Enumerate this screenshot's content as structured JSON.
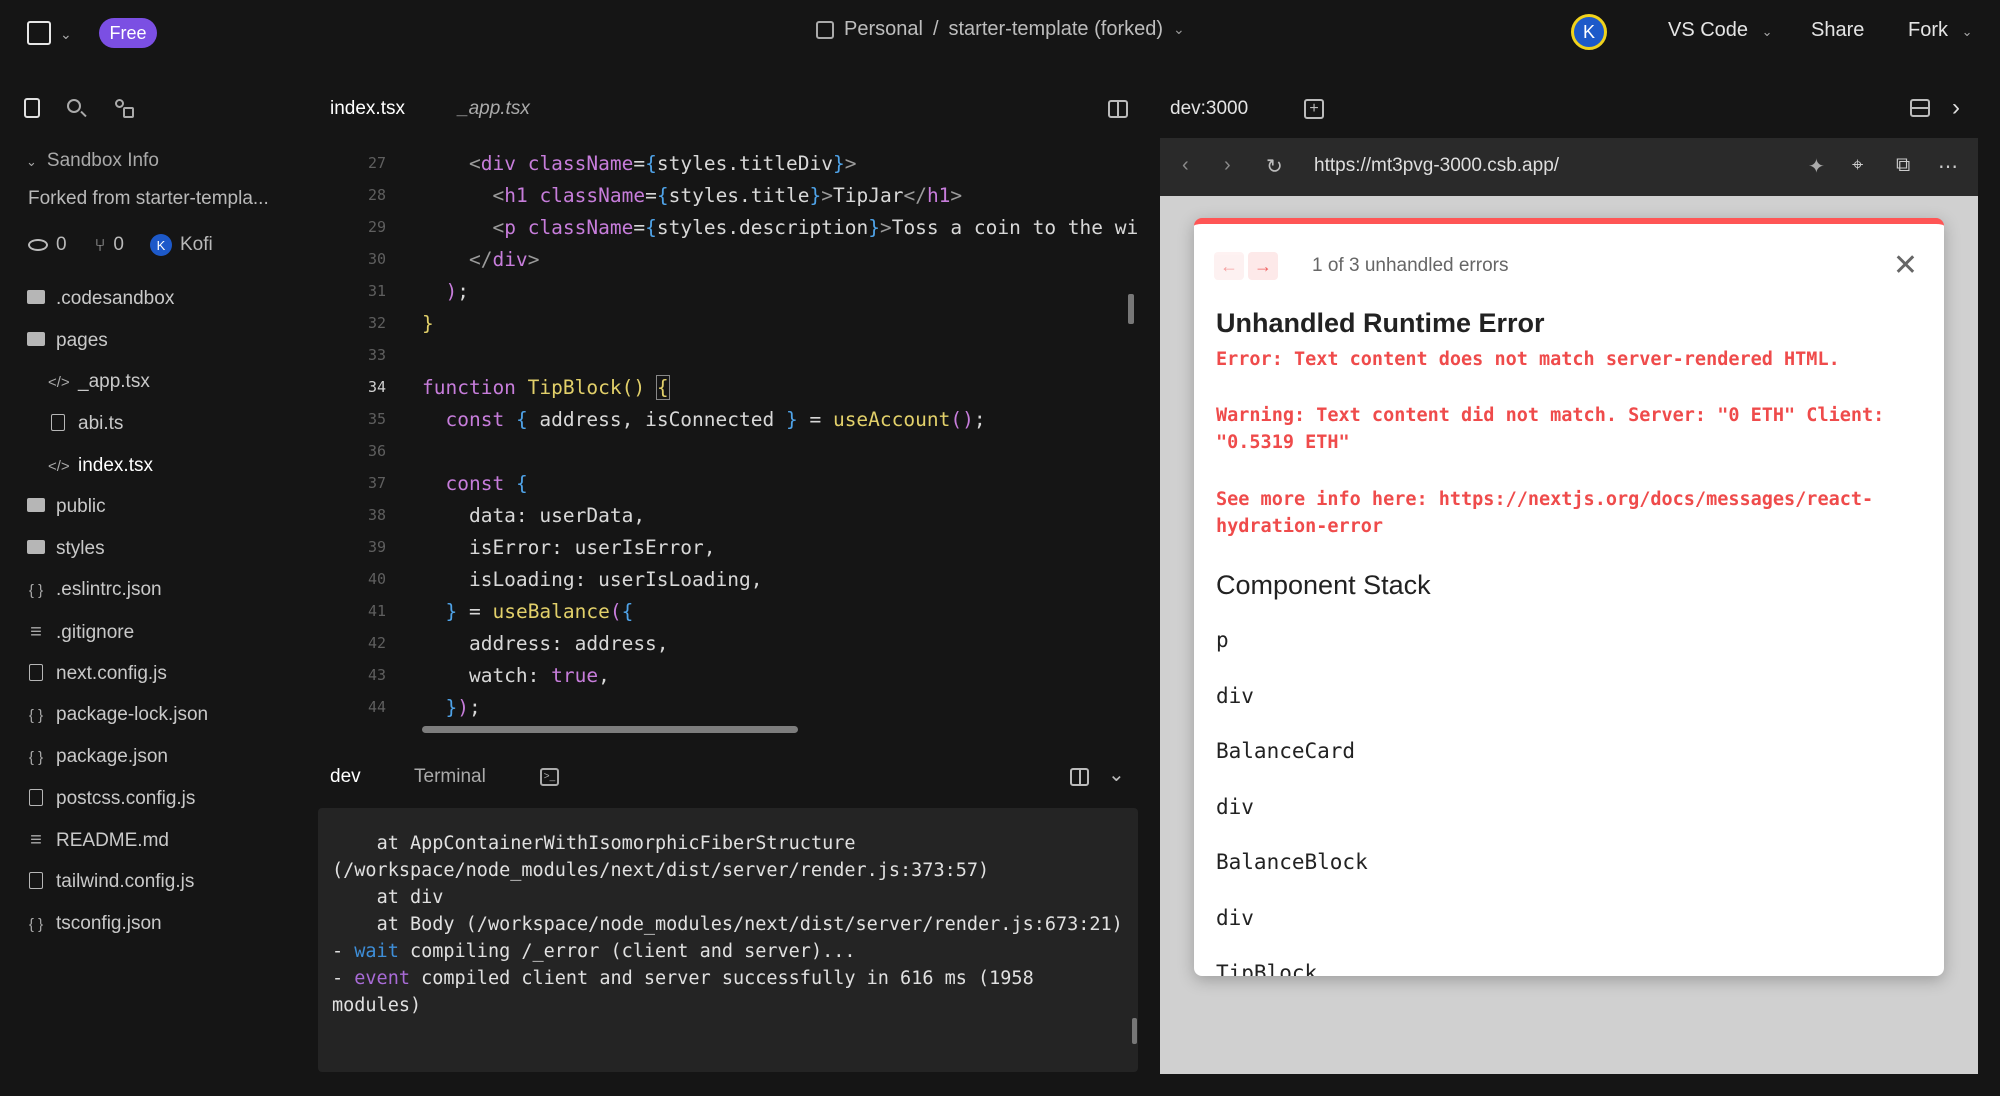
{
  "topbar": {
    "badge": "Free",
    "breadcrumb_workspace": "Personal",
    "breadcrumb_sep": "/",
    "breadcrumb_project": "starter-template (forked)",
    "avatar_letter": "K",
    "editor_select": "VS Code",
    "share": "Share",
    "fork": "Fork"
  },
  "sidebar": {
    "section_title": "Sandbox Info",
    "forked_from": "Forked from starter-templa...",
    "views": "0",
    "forks": "0",
    "author_initial": "K",
    "author": "Kofi",
    "tree": [
      {
        "label": ".codesandbox",
        "kind": "folder"
      },
      {
        "label": "pages",
        "kind": "folder-open"
      },
      {
        "label": "_app.tsx",
        "kind": "code"
      },
      {
        "label": "abi.ts",
        "kind": "file"
      },
      {
        "label": "index.tsx",
        "kind": "code"
      },
      {
        "label": "public",
        "kind": "folder"
      },
      {
        "label": "styles",
        "kind": "folder"
      },
      {
        "label": ".eslintrc.json",
        "kind": "json"
      },
      {
        "label": ".gitignore",
        "kind": "lines"
      },
      {
        "label": "next.config.js",
        "kind": "file"
      },
      {
        "label": "package-lock.json",
        "kind": "json"
      },
      {
        "label": "package.json",
        "kind": "json"
      },
      {
        "label": "postcss.config.js",
        "kind": "file"
      },
      {
        "label": "README.md",
        "kind": "lines"
      },
      {
        "label": "tailwind.config.js",
        "kind": "file"
      },
      {
        "label": "tsconfig.json",
        "kind": "json"
      }
    ]
  },
  "editor": {
    "tabs": [
      "index.tsx",
      "_app.tsx"
    ],
    "line_numbers": [
      "27",
      "28",
      "29",
      "30",
      "31",
      "32",
      "33",
      "34",
      "35",
      "36",
      "37",
      "38",
      "39",
      "40",
      "41",
      "42",
      "43",
      "44"
    ]
  },
  "terminal": {
    "tabs": [
      "dev",
      "Terminal"
    ],
    "lines": [
      "    at AppContainerWithIsomorphicFiberStructure (/workspace/node_modules/next/dist/server/render.js:373:57)",
      "    at div",
      "    at Body (/workspace/node_modules/next/dist/server/render.js:673:21)"
    ],
    "wait_prefix": "- ",
    "wait_word": "wait",
    "wait_rest": " compiling /_error (client and server)...",
    "event_prefix": "- ",
    "event_word": "event",
    "event_rest": " compiled client and server successfully in 616 ms (1958 modules)"
  },
  "preview": {
    "tab": "dev:3000",
    "url": "https://mt3pvg-3000.csb.app/",
    "error": {
      "count": "1 of 3 unhandled errors",
      "title": "Unhandled Runtime Error",
      "msg1": "Error: Text content does not match server-rendered HTML.",
      "msg2": "Warning: Text content did not match. Server: \"0 ETH\" Client: \"0.5319 ETH\"",
      "msg3": "See more info here: https://nextjs.org/docs/messages/react-hydration-error",
      "stack_title": "Component Stack",
      "stack": [
        "p",
        "div",
        "BalanceCard",
        "div",
        "BalanceBlock",
        "div",
        "TipBlock"
      ]
    }
  },
  "colors": {
    "accent_badge": "#7b4fe3",
    "error_red": "#ef4b4b",
    "avatar_blue": "#1d59c9"
  }
}
